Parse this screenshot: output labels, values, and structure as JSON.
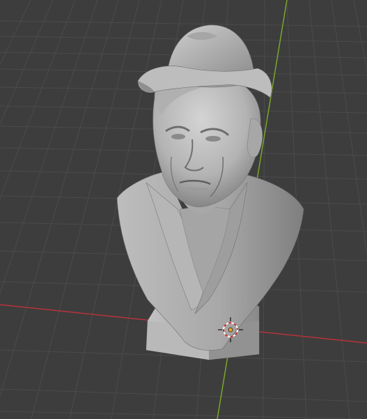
{
  "viewport": {
    "background_color": "#3d3d3d",
    "grid_color": "#4a4a4a",
    "x_axis_color": "#c3343f",
    "y_axis_color": "#7fad2a"
  },
  "model": {
    "name": "bust-sculpture",
    "shade_light": "#c9c9c9",
    "shade_mid": "#9a9a9a",
    "shade_dark": "#6a6a6a"
  },
  "cursor": {
    "icon": "3d-cursor-icon",
    "ring_color_1": "#d03030",
    "ring_color_2": "#ffffff",
    "origin_color": "#f0a020"
  }
}
